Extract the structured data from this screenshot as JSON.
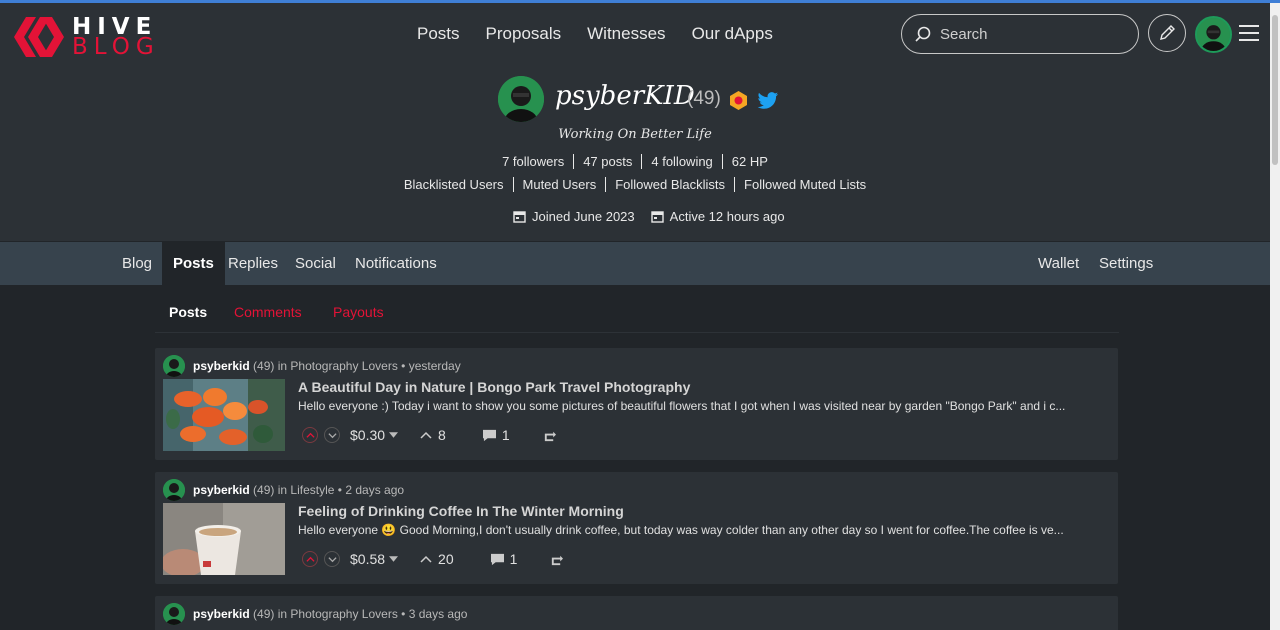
{
  "brand": {
    "line1": "HIVE",
    "line2": "BLOG"
  },
  "nav": {
    "items": [
      "Posts",
      "Proposals",
      "Witnesses",
      "Our dApps"
    ]
  },
  "search": {
    "placeholder": "Search"
  },
  "profile": {
    "name": "psyberKID",
    "reputation": "(49)",
    "about": "Working On Better Life",
    "stats": [
      "7 followers",
      "47 posts",
      "4 following",
      "62 HP"
    ],
    "lists": [
      "Blacklisted Users",
      "Muted Users",
      "Followed Blacklists",
      "Followed Muted Lists"
    ],
    "joined": "Joined June 2023",
    "active": "Active 12 hours ago"
  },
  "tabs": {
    "left": [
      "Blog",
      "Posts",
      "Replies",
      "Social",
      "Notifications"
    ],
    "right": [
      "Wallet",
      "Settings"
    ],
    "active": "Posts"
  },
  "subtabs": {
    "items": [
      "Posts",
      "Comments",
      "Payouts"
    ],
    "active": "Posts"
  },
  "posts": [
    {
      "author": "psyberkid",
      "rep": "(49)",
      "in": "in",
      "community": "Photography Lovers",
      "time": "• yesterday",
      "title": "A Beautiful Day in Nature | Bongo Park Travel Photography",
      "summary": "Hello everyone :) Today i want to show you some pictures of beautiful flowers that I got when I was visited near by garden \"Bongo Park\" and i c...",
      "payout": "$0.30",
      "votes": "8",
      "comments": "1"
    },
    {
      "author": "psyberkid",
      "rep": "(49)",
      "in": "in",
      "community": "Lifestyle",
      "time": "• 2 days ago",
      "title": "Feeling of Drinking Coffee In The Winter Morning",
      "summary": "Hello everyone 😃 Good Morning,I don't usually drink coffee, but today was way colder than any other day so I went for coffee.The coffee is ve...",
      "payout": "$0.58",
      "votes": "20",
      "comments": "1"
    },
    {
      "author": "psyberkid",
      "rep": "(49)",
      "in": "in",
      "community": "Photography Lovers",
      "time": "• 3 days ago"
    }
  ],
  "colors": {
    "accent": "#e31337",
    "background": "#212529",
    "header": "#2c3136",
    "tabbar": "#37434d"
  }
}
